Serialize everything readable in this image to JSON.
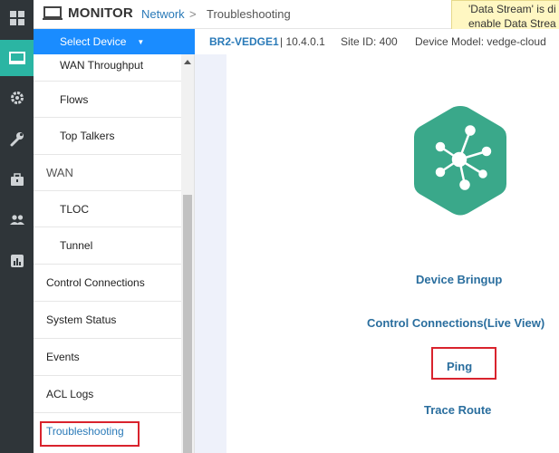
{
  "header": {
    "app_title": "MONITOR",
    "breadcrumb": [
      "Network",
      ">",
      "Troubleshooting"
    ]
  },
  "alert": {
    "line1": "'Data Stream' is di",
    "line2": "enable Data Strea"
  },
  "rail": {
    "items": [
      "dashboard-icon",
      "monitor-icon",
      "configuration-gear-icon",
      "tools-wrench-icon",
      "maintenance-briefcase-icon",
      "administration-users-icon",
      "analytics-chart-icon"
    ],
    "active": "monitor-icon",
    "accent": "#2bb5a3"
  },
  "sidebar": {
    "select_device_label": "Select Device",
    "items": [
      "WAN Throughput",
      "Flows",
      "Top Talkers",
      "WAN",
      "TLOC",
      "Tunnel",
      "Control Connections",
      "System Status",
      "Events",
      "ACL Logs",
      "Troubleshooting"
    ]
  },
  "device": {
    "name": "BR2-VEDGE1",
    "version": "| 10.4.0.1",
    "site_id": "Site ID: 400",
    "model": "Device Model: vedge-cloud"
  },
  "tools": {
    "device_bringup": "Device Bringup",
    "control_connections_live": "Control Connections(Live View)",
    "ping": "Ping",
    "trace_route": "Trace Route"
  },
  "colors": {
    "brand_blue": "#1a8cff",
    "link_blue": "#2a7ab8",
    "hex_green": "#3aa88a",
    "highlight_red": "#d9232d"
  }
}
